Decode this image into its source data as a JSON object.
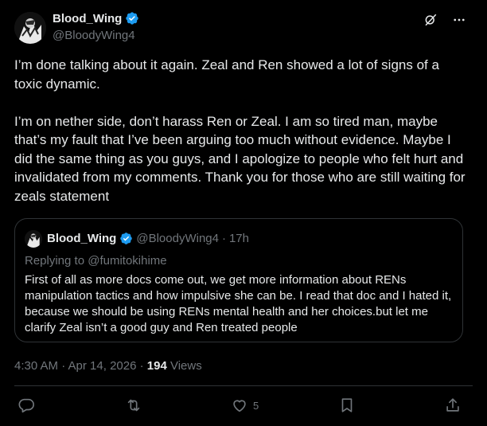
{
  "author": {
    "display_name": "Blood_Wing",
    "handle": "@BloodyWing4"
  },
  "post": {
    "text": "I’m done talking about it again. Zeal and Ren showed a lot of signs of a toxic dynamic.\n\nI’m on nether side, don’t harass Ren or Zeal. I am so tired man, maybe that’s my fault that I’ve been arguing too much without evidence. Maybe I did the same thing as you guys, and I apologize to people who felt hurt and invalidated from my comments. Thank you for those who are still waiting for zeals statement"
  },
  "quote": {
    "display_name": "Blood_Wing",
    "handle": "@BloodyWing4",
    "separator": "·",
    "time": "17h",
    "replying_prefix": "Replying to",
    "replying_to": "@fumitokihime",
    "text": "First of all as more docs come out, we get more information about RENs manipulation tactics and how impulsive she can be. I read that doc and I hated it, because we should be using RENs mental health and her choices.but let me clarify Zeal isn’t a good guy and Ren treated people"
  },
  "meta": {
    "timestamp": "4:30 AM · Apr 14, 2026 · ",
    "views_count": "194",
    "views_label": " Views"
  },
  "actions": {
    "like_count": "5"
  },
  "colors": {
    "background": "#000000",
    "text": "#e7e9ea",
    "secondary": "#71767b",
    "border": "#2f3336",
    "verified": "#1d9bf0"
  },
  "icons": [
    "verified-badge-icon",
    "grok-icon",
    "more-icon",
    "reply-icon",
    "repost-icon",
    "like-icon",
    "bookmark-icon",
    "share-icon"
  ]
}
